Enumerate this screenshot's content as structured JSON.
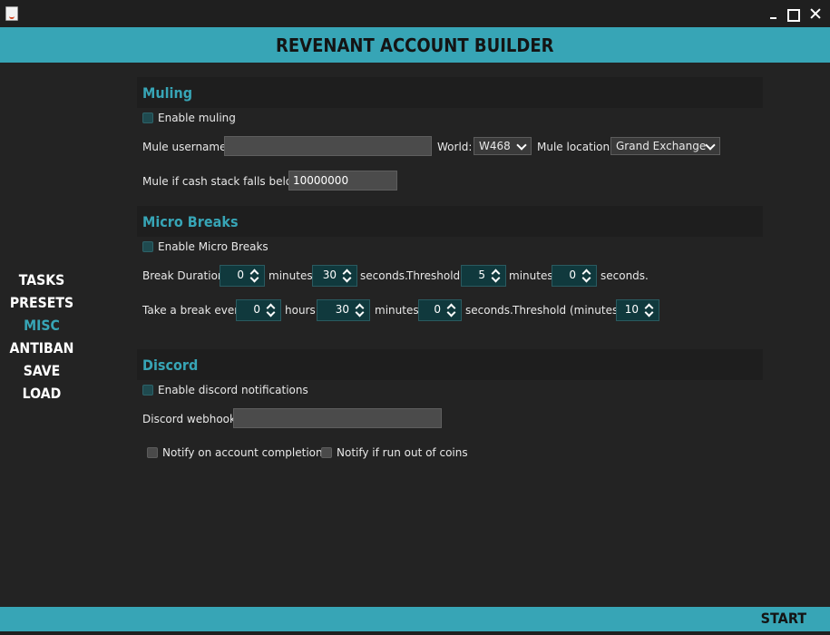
{
  "window": {
    "title": ""
  },
  "header": {
    "title": "REVENANT ACCOUNT BUILDER"
  },
  "sidebar": {
    "items": [
      {
        "label": "TASKS",
        "active": false
      },
      {
        "label": "PRESETS",
        "active": false
      },
      {
        "label": "MISC",
        "active": true
      },
      {
        "label": "ANTIBAN",
        "active": false
      },
      {
        "label": "SAVE",
        "active": false
      },
      {
        "label": "LOAD",
        "active": false
      }
    ]
  },
  "muling": {
    "title": "Muling",
    "enable_label": "Enable muling",
    "enable_checked": false,
    "username_label": "Mule username:",
    "username_value": "",
    "world_label": "World:",
    "world_value": "W468",
    "location_label": "Mule location:",
    "location_value": "Grand Exchange",
    "cash_label": "Mule if cash stack falls below:",
    "cash_value": "10000000"
  },
  "micro_breaks": {
    "title": "Micro Breaks",
    "enable_label": "Enable Micro Breaks",
    "enable_checked": false,
    "duration_label": "Break Duration:",
    "duration_minutes": "0",
    "minutes_label": "minutes",
    "duration_seconds": "30",
    "seconds_label": "seconds.",
    "threshold_label": "Threshold:",
    "threshold_minutes": "5",
    "threshold_seconds": "0",
    "every_label": "Take a break every:",
    "every_hours": "0",
    "hours_label": "hours",
    "every_minutes": "30",
    "every_seconds": "0",
    "threshold_minutes_label": "Threshold (minutes):",
    "every_threshold": "10"
  },
  "discord": {
    "title": "Discord",
    "enable_label": "Enable discord notifications",
    "enable_checked": false,
    "webhook_label": "Discord webhook:",
    "webhook_value": "",
    "notify_completion_label": "Notify on account completion",
    "notify_coins_label": "Notify if run out of coins"
  },
  "footer": {
    "start_label": "START"
  },
  "colors": {
    "accent": "#37a5b6",
    "background": "#232323",
    "section_header": "#1e1e1e",
    "spinner_bg": "#10393d"
  }
}
